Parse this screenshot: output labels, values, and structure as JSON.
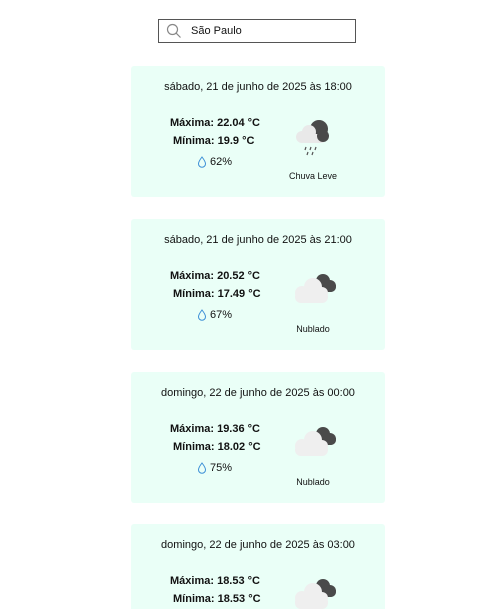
{
  "search": {
    "value": "São Paulo",
    "icon": "search-icon"
  },
  "forecasts": [
    {
      "date": "sábado, 21 de junho de 2025 às 18:00",
      "max": "Máxima: 22.04 °C",
      "min": "Mínima: 19.9 °C",
      "humidity": "62%",
      "description": "Chuva Leve",
      "icon": "rain-cloud-icon"
    },
    {
      "date": "sábado, 21 de junho de 2025 às 21:00",
      "max": "Máxima: 20.52 °C",
      "min": "Mínima: 17.49 °C",
      "humidity": "67%",
      "description": "Nublado",
      "icon": "cloudy-icon"
    },
    {
      "date": "domingo, 22 de junho de 2025 às 00:00",
      "max": "Máxima: 19.36 °C",
      "min": "Mínima: 18.02 °C",
      "humidity": "75%",
      "description": "Nublado",
      "icon": "cloudy-icon"
    },
    {
      "date": "domingo, 22 de junho de 2025 às 03:00",
      "max": "Máxima: 18.53 °C",
      "min": "Mínima: 18.53 °C",
      "humidity": "",
      "description": "",
      "icon": "cloudy-icon"
    }
  ],
  "colors": {
    "card_bg": "#eafff7",
    "drop": "#3b8fd6",
    "cloud_dark": "#555555",
    "cloud_light": "#f0f0f0"
  }
}
